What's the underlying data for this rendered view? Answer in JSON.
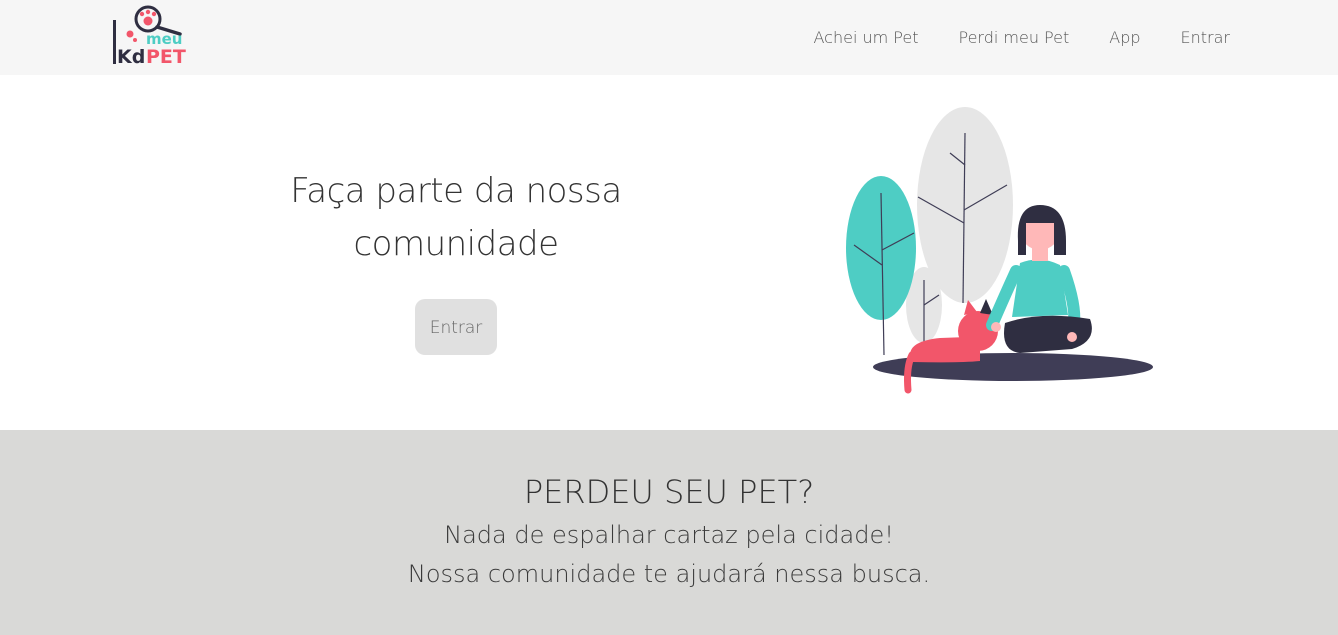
{
  "brand": {
    "logo_prefix": "Kd",
    "logo_top": "meu",
    "logo_main": "PET",
    "colors": {
      "teal": "#4ecdc4",
      "pink": "#f2566a",
      "dark": "#2f2e41"
    }
  },
  "nav": {
    "items": [
      {
        "label": "Achei um Pet"
      },
      {
        "label": "Perdi meu Pet"
      },
      {
        "label": "App"
      },
      {
        "label": "Entrar"
      }
    ]
  },
  "hero": {
    "title_line1": "Faça parte da nossa",
    "title_line2": "comunidade",
    "button_label": "Entrar",
    "illustration": "woman-with-cat-and-trees"
  },
  "lost_section": {
    "title": "PERDEU SEU PET?",
    "line1": "Nada de espalhar cartaz pela cidade!",
    "line2": "Nossa comunidade te ajudará nessa busca."
  }
}
